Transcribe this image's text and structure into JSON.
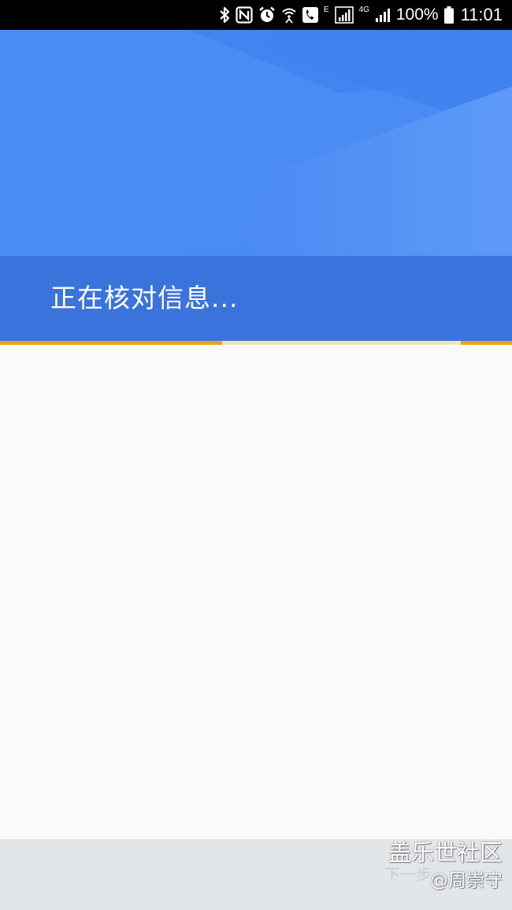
{
  "status_bar": {
    "network_e": "E",
    "network_4g": "4G",
    "battery_percent": "100%",
    "time": "11:01",
    "icons": [
      "bluetooth-icon",
      "nfc-icon",
      "alarm-icon",
      "wifi-call-icon",
      "phone-call-icon",
      "signal-icon",
      "signal-icon",
      "battery-icon"
    ]
  },
  "header": {
    "title": "正在核对信息..."
  },
  "progress": {
    "indeterminate": true,
    "colors": {
      "bar": "#e8a325",
      "track": "#f2e3bd"
    }
  },
  "bottom_bar": {
    "next_label": "下一步"
  },
  "watermark": {
    "site": "盖乐世社区",
    "author": "@周崇守"
  },
  "colors": {
    "header_bg": "#4a89f3",
    "title_bar_bg": "#3b73dd",
    "content_bg": "#fafafa",
    "bottom_bar_bg": "#e3e6e9"
  }
}
